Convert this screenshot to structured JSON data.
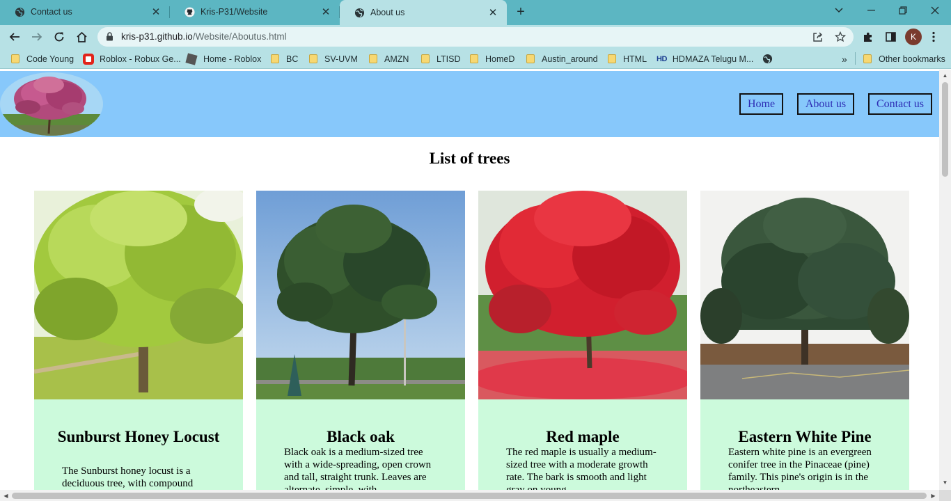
{
  "browser": {
    "tabs": [
      {
        "title": "Contact us",
        "icon": "globe-icon",
        "active": false
      },
      {
        "title": "Kris-P31/Website",
        "icon": "github-icon",
        "active": false
      },
      {
        "title": "About us",
        "icon": "globe-icon",
        "active": true
      }
    ],
    "url_host": "kris-p31.github.io",
    "url_path": "/Website/Aboutus.html",
    "profile_initial": "K",
    "bookmarks": [
      {
        "label": "Code Young",
        "icon": "folder-icon"
      },
      {
        "label": "Roblox - Robux Ge...",
        "icon": "roblox-red-icon"
      },
      {
        "label": "Home - Roblox",
        "icon": "roblox-icon"
      },
      {
        "label": "BC",
        "icon": "folder-icon"
      },
      {
        "label": "SV-UVM",
        "icon": "folder-icon"
      },
      {
        "label": "AMZN",
        "icon": "folder-icon"
      },
      {
        "label": "LTISD",
        "icon": "folder-icon"
      },
      {
        "label": "HomeD",
        "icon": "folder-icon"
      },
      {
        "label": "Austin_around",
        "icon": "folder-icon"
      },
      {
        "label": "HTML",
        "icon": "folder-icon"
      },
      {
        "label": "HDMAZA Telugu M...",
        "icon": "hd-icon"
      }
    ],
    "hd_badge": "HD",
    "more_bookmarks": "»",
    "other_bookmarks": "Other bookmarks"
  },
  "site": {
    "nav": [
      "Home",
      "About us",
      "Contact us"
    ],
    "page_title": "List of trees",
    "trees": [
      {
        "name": "Sunburst Honey Locust",
        "description": "The Sunburst honey locust is a deciduous tree, with compound"
      },
      {
        "name": "Black oak",
        "description": "Black oak is a medium-sized tree with a wide-spreading, open crown and tall, straight trunk. Leaves are alternate, simple, with"
      },
      {
        "name": "Red maple",
        "description": "The red maple is usually a medium-sized tree with a moderate growth rate. The bark is smooth and light gray on young"
      },
      {
        "name": "Eastern White Pine",
        "description": "Eastern white pine is an evergreen conifer tree in the Pinaceae (pine) family. This pine's origin is in the northeastern"
      }
    ]
  },
  "colors": {
    "tabstrip": "#5cb6c2",
    "toolbar": "#b7e1e5",
    "site_header": "#87c8fb",
    "card_bg": "#ccfadc",
    "nav_text": "#2c2bb3"
  }
}
